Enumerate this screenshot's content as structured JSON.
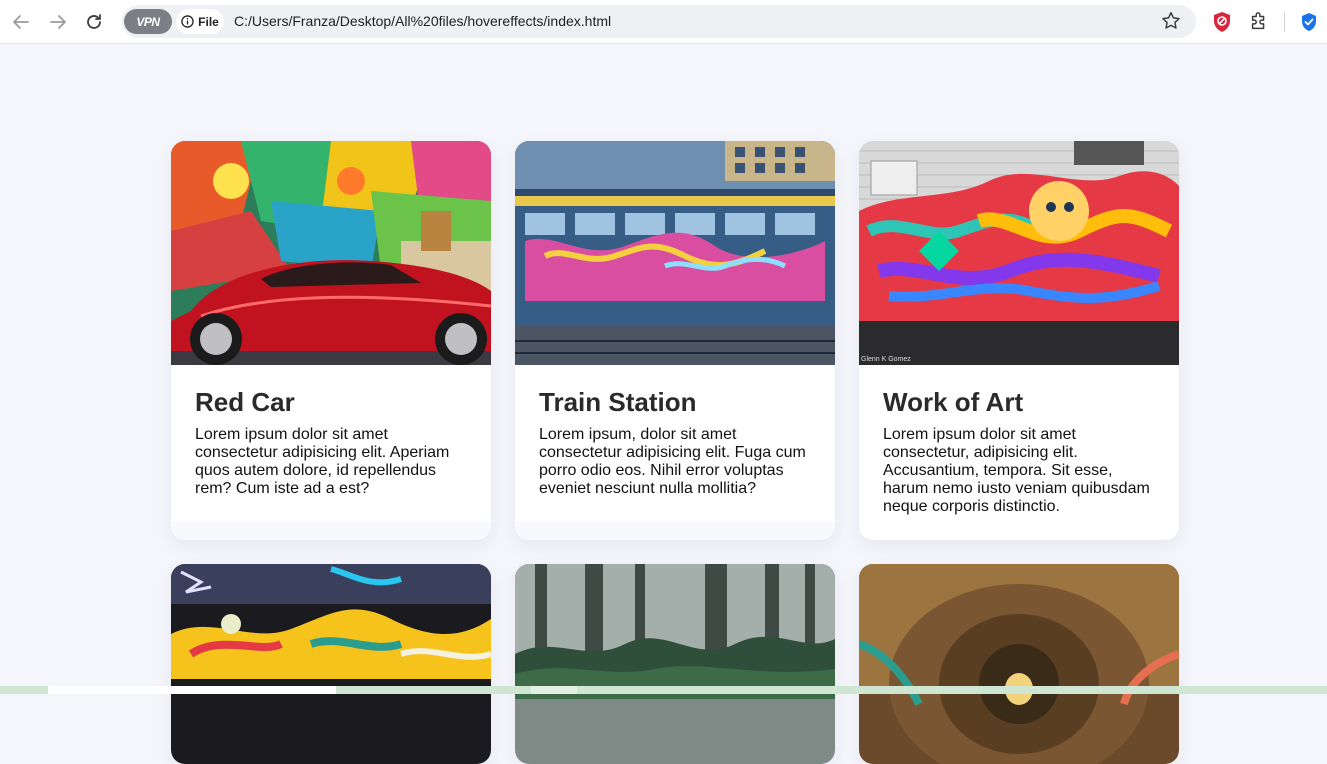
{
  "browser": {
    "vpn_label": "VPN",
    "file_label": "File",
    "url": "C:/Users/Franza/Desktop/All%20files/hovereffects/index.html"
  },
  "cards": [
    {
      "title": "Red Car",
      "text": "Lorem ipsum dolor sit amet consectetur adipisicing elit. Aperiam quos autem dolore, id repellendus rem? Cum iste ad a est?"
    },
    {
      "title": "Train Station",
      "text": "Lorem ipsum, dolor sit amet consectetur adipisicing elit. Fuga cum porro odio eos. Nihil error voluptas eveniet nesciunt nulla mollitia?"
    },
    {
      "title": "Work of Art",
      "text": "Lorem ipsum dolor sit amet consectetur, adipisicing elit. Accusantium, tempora. Sit esse, harum nemo iusto veniam quibusdam neque corporis distinctio."
    }
  ],
  "photo_watermark": "Glenn K Gomez",
  "colors": {
    "page_bg": "#f5f6fb",
    "card_bg": "#ffffff",
    "title_color": "#2a2a2a",
    "shield_red": "#d7263d",
    "shield_blue": "#1a73e8"
  },
  "icons": [
    "back-arrow-icon",
    "forward-arrow-icon",
    "reload-icon",
    "info-icon",
    "star-icon",
    "shield-extension-icon",
    "puzzle-icon",
    "verified-shield-icon"
  ]
}
